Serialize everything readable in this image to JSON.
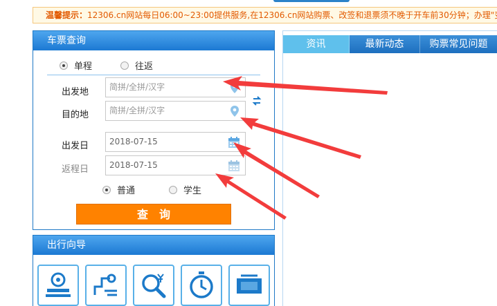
{
  "notice": {
    "label": "温馨提示：",
    "text": "12306.cn网站每日06:00~23:00提供服务,在12306.cn网站购票、改签和退票须不晚于开车前30分钟；办理\"变更"
  },
  "query": {
    "title": "车票查询",
    "trip_types": [
      {
        "label": "单程",
        "checked": true
      },
      {
        "label": "往返",
        "checked": false
      }
    ],
    "from": {
      "label": "出发地",
      "placeholder": "简拼/全拼/汉字"
    },
    "to": {
      "label": "目的地",
      "placeholder": "简拼/全拼/汉字"
    },
    "depart": {
      "label": "出发日",
      "value": "2018-07-15"
    },
    "return": {
      "label": "返程日",
      "value": "2018-07-15"
    },
    "ticket_types": [
      {
        "label": "普通",
        "checked": true
      },
      {
        "label": "学生",
        "checked": false
      }
    ],
    "search_label": "查询"
  },
  "guide": {
    "title": "出行向导",
    "icons": [
      "train-station-icon",
      "railway-line-icon",
      "fare-search-icon",
      "timetable-clock-icon",
      "ticket-icon"
    ]
  },
  "info": {
    "tabs": [
      {
        "label": "资讯",
        "active": true
      },
      {
        "label": "最新动态",
        "active": false
      },
      {
        "label": "购票常见问题",
        "active": false
      }
    ]
  },
  "colors": {
    "accent_blue": "#1c79d3",
    "search_orange": "#ff8200",
    "notice_text": "#e25a00",
    "annotation_red": "#f23c3c"
  }
}
